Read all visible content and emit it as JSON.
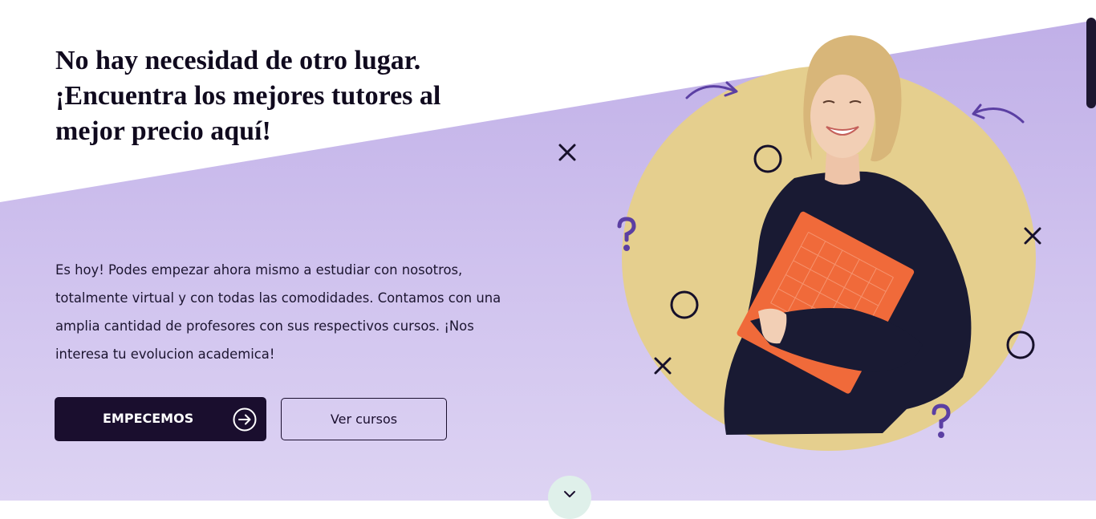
{
  "hero": {
    "headline": "No hay necesidad de otro lugar. ¡Encuentra los mejores tutores al mejor precio aquí!",
    "description": "Es hoy! Podes empezar ahora mismo a estudiar con nosotros, totalmente virtual y con todas las comodidades. Contamos con una amplia cantidad de profesores con sus respectivos cursos. ¡Nos interesa tu evolucion academica!",
    "primary_button": {
      "label": "EMPECEMOS",
      "icon": "arrow-right-circle-icon"
    },
    "secondary_button": {
      "label": "Ver cursos"
    },
    "scroll_button_icon": "chevron-down-icon",
    "illustration_decorations": [
      "question-mark-icon",
      "x-mark-icon",
      "circle-outline-icon",
      "curved-arrow-icon"
    ]
  },
  "colors": {
    "accent_purple": "#c3b3e8",
    "dark_primary": "#1a0e2e",
    "illustration_circle": "#e5cf8e",
    "folder_orange": "#f06a3a",
    "decoration_purple": "#5b3fa3"
  }
}
